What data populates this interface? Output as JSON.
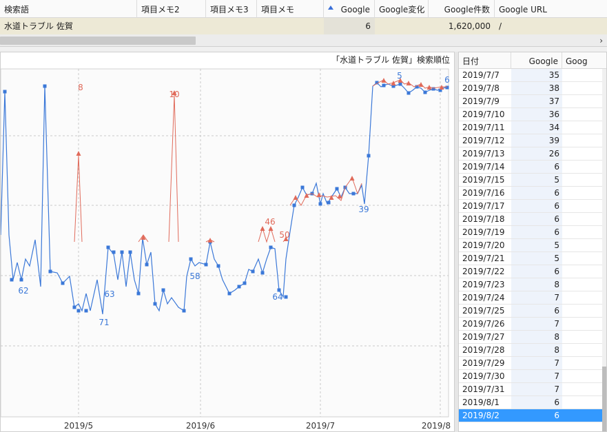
{
  "header": {
    "columns": [
      "検索語",
      "項目メモ2",
      "項目メモ3",
      "項目メモ",
      "Google",
      "Google変化",
      "Google件数",
      "Google URL"
    ]
  },
  "row": {
    "keyword": "水道トラブル 佐賀",
    "google": "6",
    "google_count": "1,620,000",
    "google_url": "/"
  },
  "chart": {
    "title": "「水道トラブル 佐賀」検索順位",
    "x_ticks": [
      "2019/5",
      "2019/6",
      "2019/7",
      "2019/8"
    ],
    "colors": {
      "blue": "#3b78d8",
      "red": "#e06a5a",
      "grid": "#c8c8c8"
    }
  },
  "chart_data": {
    "type": "line",
    "title": "「水道トラブル 佐賀」検索順位",
    "x_ticks": [
      "2019/5",
      "2019/6",
      "2019/7",
      "2019/8"
    ],
    "y_axis": "rank (inverted)",
    "ylim": [
      1,
      100
    ],
    "grid": true,
    "series": [
      {
        "name": "Google",
        "color": "#3b78d8",
        "labels": [
          "5",
          "6",
          "39",
          "58",
          "62",
          "63",
          "64",
          "71"
        ]
      },
      {
        "name": "",
        "color": "#e06a5a",
        "labels": [
          "8",
          "10",
          "46",
          "50"
        ]
      }
    ]
  },
  "table": {
    "headers": [
      "日付",
      "Google",
      "Goog"
    ],
    "rows": [
      [
        "2019/7/7",
        "35"
      ],
      [
        "2019/7/8",
        "38"
      ],
      [
        "2019/7/9",
        "37"
      ],
      [
        "2019/7/10",
        "36"
      ],
      [
        "2019/7/11",
        "34"
      ],
      [
        "2019/7/12",
        "39"
      ],
      [
        "2019/7/13",
        "26"
      ],
      [
        "2019/7/14",
        "6"
      ],
      [
        "2019/7/15",
        "5"
      ],
      [
        "2019/7/16",
        "6"
      ],
      [
        "2019/7/17",
        "6"
      ],
      [
        "2019/7/18",
        "6"
      ],
      [
        "2019/7/19",
        "6"
      ],
      [
        "2019/7/20",
        "5"
      ],
      [
        "2019/7/21",
        "5"
      ],
      [
        "2019/7/22",
        "6"
      ],
      [
        "2019/7/23",
        "8"
      ],
      [
        "2019/7/24",
        "7"
      ],
      [
        "2019/7/25",
        "6"
      ],
      [
        "2019/7/26",
        "7"
      ],
      [
        "2019/7/27",
        "8"
      ],
      [
        "2019/7/28",
        "8"
      ],
      [
        "2019/7/29",
        "7"
      ],
      [
        "2019/7/30",
        "7"
      ],
      [
        "2019/7/31",
        "7"
      ],
      [
        "2019/8/1",
        "6"
      ],
      [
        "2019/8/2",
        "6"
      ]
    ],
    "selected_index": 26
  },
  "scroll": {
    "right_arrow": "›"
  }
}
